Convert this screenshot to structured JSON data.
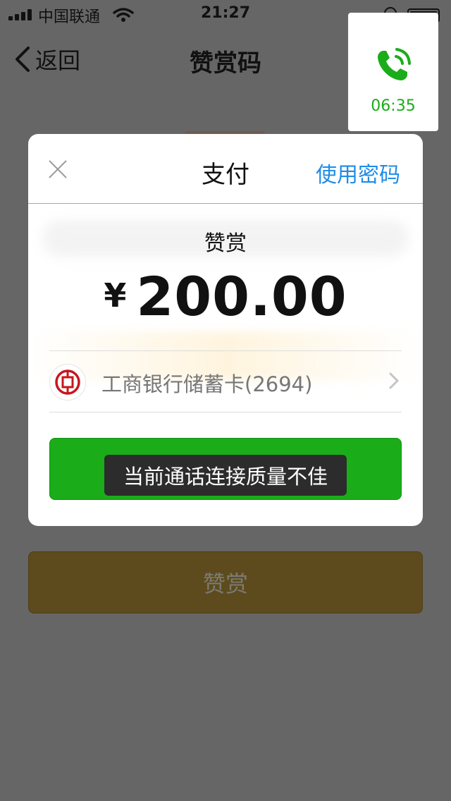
{
  "status_bar": {
    "carrier": "中国联通",
    "time": "21:27"
  },
  "nav": {
    "back_label": "返回",
    "title": "赞赏码"
  },
  "call": {
    "duration": "06:35",
    "icon": "phone-icon",
    "color": "#1aad19"
  },
  "dialog": {
    "title": "支付",
    "use_password": "使用密码",
    "pay_label": "赞赏",
    "currency": "¥",
    "amount": "200.00",
    "card_name": "工商银行储蓄卡(2694)",
    "bank_icon": "icbc-logo-icon"
  },
  "toast": {
    "message": "当前通话连接质量不佳"
  },
  "background": {
    "reward_button_label": "赞赏"
  },
  "colors": {
    "accent_green": "#1aad19",
    "link_blue": "#1f8ce8",
    "icbc_red": "#c7161e"
  }
}
